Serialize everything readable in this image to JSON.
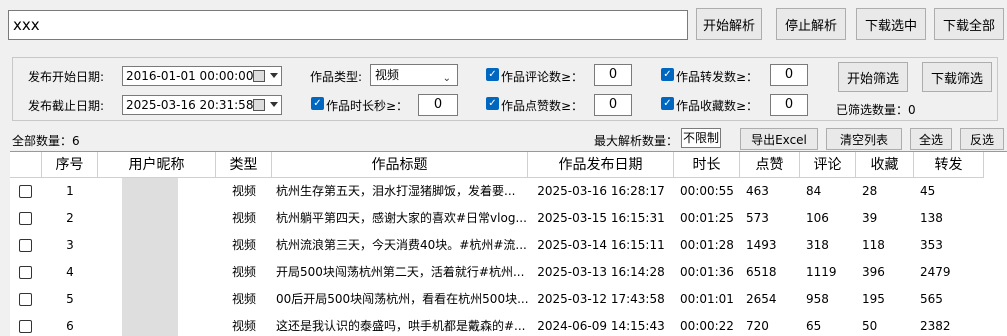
{
  "toolbar": {
    "url_value": "xxx",
    "start_parse": "开始解析",
    "stop_parse": "停止解析",
    "download_selected": "下载选中",
    "download_all": "下载全部"
  },
  "filters": {
    "start_date_label": "发布开始日期:",
    "start_date_value": "2016-01-01 00:00:00",
    "end_date_label": "发布截止日期:",
    "end_date_value": "2025-03-16 20:31:58",
    "type_label": "作品类型:",
    "type_value": "视频",
    "duration_label": "作品时长秒≥：",
    "duration_value": "0",
    "comments_label": "作品评论数≥：",
    "comments_value": "0",
    "likes_label": "作品点赞数≥：",
    "likes_value": "0",
    "shares_label": "作品转发数≥：",
    "shares_value": "0",
    "favorites_label": "作品收藏数≥：",
    "favorites_value": "0",
    "start_filter": "开始筛选",
    "download_filter": "下载筛选",
    "filtered_count_label": "已筛选数量：",
    "filtered_count_value": "0"
  },
  "summary": {
    "total_label": "全部数量：",
    "total_value": "6",
    "max_parse_label": "最大解析数量：",
    "max_parse_value": "不限制",
    "export_excel": "导出Excel",
    "clear_list": "清空列表",
    "select_all": "全选",
    "invert_select": "反选"
  },
  "table": {
    "headers": [
      "序号",
      "用户昵称",
      "类型",
      "作品标题",
      "作品发布日期",
      "时长",
      "点赞",
      "评论",
      "收藏",
      "转发"
    ],
    "rows": [
      {
        "idx": "1",
        "type": "视频",
        "title": "杭州生存第五天，泪水打湿猪脚饭，发着要...",
        "date": "2025-03-16 16:28:17",
        "dur": "00:00:55",
        "likes": "463",
        "comments": "84",
        "fav": "28",
        "shares": "45"
      },
      {
        "idx": "2",
        "type": "视频",
        "title": "杭州躺平第四天，感谢大家的喜欢#日常vlog...",
        "date": "2025-03-15 16:15:31",
        "dur": "00:01:25",
        "likes": "573",
        "comments": "106",
        "fav": "39",
        "shares": "138"
      },
      {
        "idx": "3",
        "type": "视频",
        "title": "杭州流浪第三天，今天消费40块。#杭州#流...",
        "date": "2025-03-14 16:15:11",
        "dur": "00:01:28",
        "likes": "1493",
        "comments": "318",
        "fav": "118",
        "shares": "353"
      },
      {
        "idx": "4",
        "type": "视频",
        "title": "开局500块闯荡杭州第二天，活着就行#杭州...",
        "date": "2025-03-13 16:14:28",
        "dur": "00:01:36",
        "likes": "6518",
        "comments": "1119",
        "fav": "396",
        "shares": "2479"
      },
      {
        "idx": "5",
        "type": "视频",
        "title": "00后开局500块闯荡杭州，看看在杭州500块...",
        "date": "2025-03-12 17:43:58",
        "dur": "00:01:01",
        "likes": "2654",
        "comments": "958",
        "fav": "195",
        "shares": "565"
      },
      {
        "idx": "6",
        "type": "视频",
        "title": "这还是我认识的泰盛吗，哄手机都是戴森的#...",
        "date": "2024-06-09 14:15:43",
        "dur": "00:00:22",
        "likes": "720",
        "comments": "65",
        "fav": "50",
        "shares": "2382"
      }
    ]
  }
}
